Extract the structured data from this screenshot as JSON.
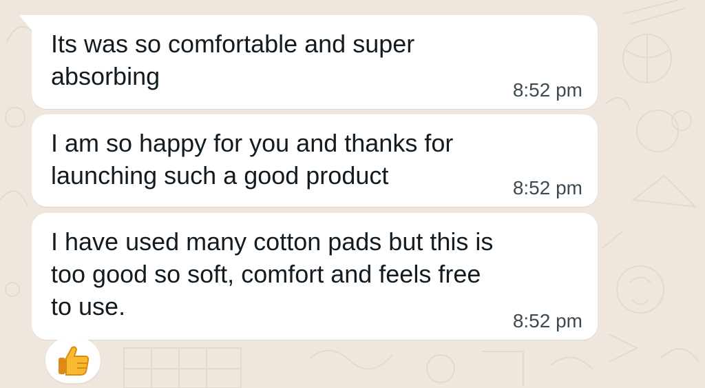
{
  "messages": [
    {
      "text": "Its was so comfortable and super\nabsorbing",
      "time": "8:52 pm"
    },
    {
      "text": "I am so happy for you and thanks for\nlaunching such a good product",
      "time": "8:52 pm"
    },
    {
      "text": "I have used many cotton pads but this is\ntoo good so soft, comfort and feels free\nto use.",
      "time": "8:52 pm"
    }
  ],
  "reaction": {
    "emoji": "thumbs-up-icon"
  },
  "colors": {
    "wallpaper": "#efe7dd",
    "bubble": "#ffffff",
    "text": "#111b21",
    "time": "#3b4a54"
  }
}
